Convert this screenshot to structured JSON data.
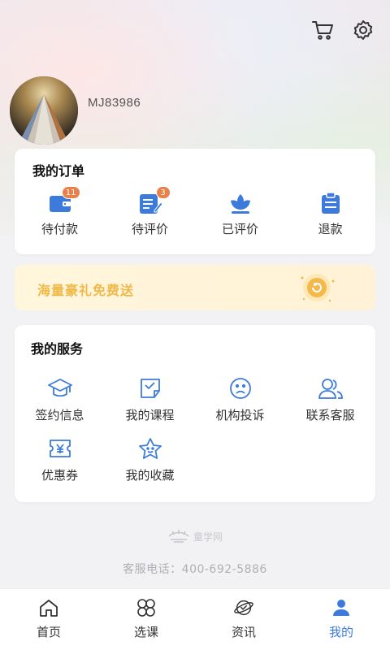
{
  "header": {
    "username": "MJ83986",
    "icons": [
      "cart-icon",
      "settings-icon"
    ]
  },
  "orders": {
    "title": "我的订单",
    "items": [
      {
        "label": "待付款",
        "badge": "11",
        "icon": "wallet-icon"
      },
      {
        "label": "待评价",
        "badge": "3",
        "icon": "review-pending-icon"
      },
      {
        "label": "已评价",
        "badge": "",
        "icon": "reviewed-icon"
      },
      {
        "label": "退款",
        "badge": "",
        "icon": "refund-icon"
      }
    ]
  },
  "promo": {
    "text": "海量豪礼免费送",
    "icon": "gift-coin-icon"
  },
  "services": {
    "title": "我的服务",
    "items": [
      {
        "label": "签约信息",
        "icon": "graduation-cap-icon"
      },
      {
        "label": "我的课程",
        "icon": "course-icon"
      },
      {
        "label": "机构投诉",
        "icon": "sad-face-icon"
      },
      {
        "label": "联系客服",
        "icon": "contacts-icon"
      },
      {
        "label": "优惠券",
        "icon": "coupon-icon"
      },
      {
        "label": "我的收藏",
        "icon": "star-icon"
      }
    ]
  },
  "footer": {
    "brand": "童学网",
    "hotline": "客服电话：400-692-5886"
  },
  "tabbar": {
    "items": [
      {
        "label": "首页",
        "icon": "home-icon",
        "active": false
      },
      {
        "label": "选课",
        "icon": "course-select-icon",
        "active": false
      },
      {
        "label": "资讯",
        "icon": "news-icon",
        "active": false
      },
      {
        "label": "我的",
        "icon": "profile-icon",
        "active": true
      }
    ]
  },
  "colors": {
    "accent": "#3c7bdc",
    "badge": "#e8804a",
    "promo_text": "#f0b848"
  }
}
